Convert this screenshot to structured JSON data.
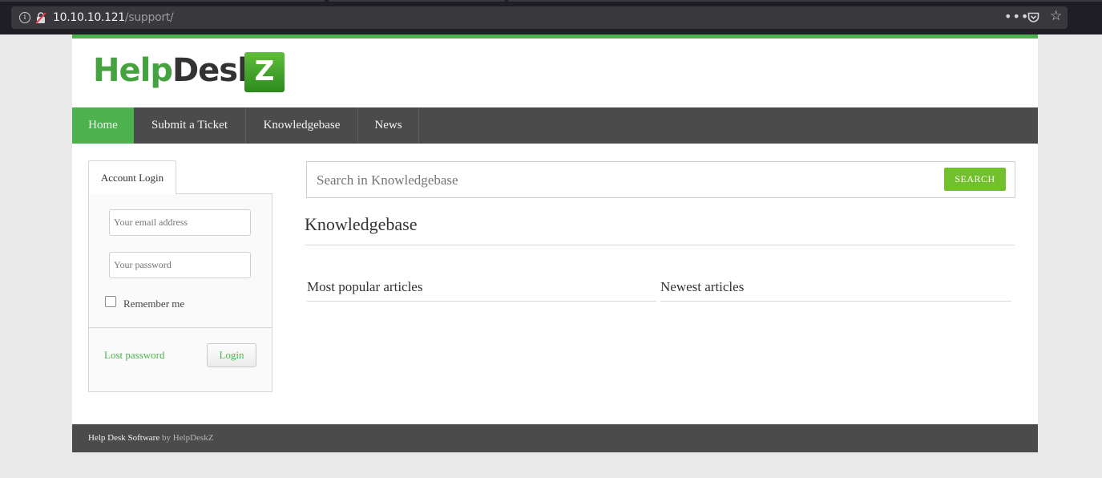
{
  "browser": {
    "url_host": "10.10.10.121",
    "url_path": "/support/",
    "icons": [
      "info-icon",
      "lock-icon",
      "more-icon",
      "pocket-icon",
      "star-icon"
    ]
  },
  "logo": {
    "help": "Help",
    "desk": "Desk",
    "z": "Z"
  },
  "nav": {
    "items": [
      {
        "label": "Home",
        "active": true
      },
      {
        "label": "Submit a Ticket",
        "active": false
      },
      {
        "label": "Knowledgebase",
        "active": false
      },
      {
        "label": "News",
        "active": false
      }
    ]
  },
  "login": {
    "tab_label": "Account Login",
    "email_placeholder": "Your email address",
    "password_placeholder": "Your password",
    "remember_label": "Remember me",
    "lost_password": "Lost password",
    "login_button": "Login"
  },
  "search": {
    "placeholder": "Search in Knowledgebase",
    "button": "SEARCH"
  },
  "kb": {
    "title": "Knowledgebase",
    "popular": "Most popular articles",
    "newest": "Newest articles"
  },
  "footer": {
    "software": "Help Desk Software",
    "by": " by HelpDeskZ"
  },
  "colors": {
    "accent": "#4db24d",
    "nav_bg": "#4b4b4b",
    "search_button": "#72c02c"
  }
}
